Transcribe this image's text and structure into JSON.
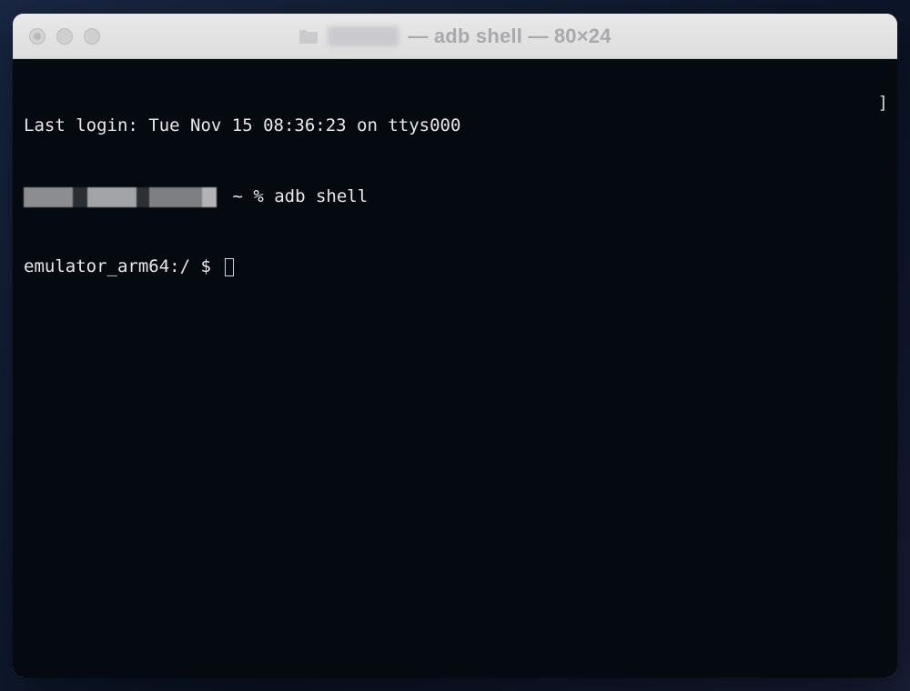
{
  "titlebar": {
    "title_suffix": "— adb shell — 80×24",
    "folder_icon_name": "folder-icon"
  },
  "terminal": {
    "last_login": "Last login: Tue Nov 15 08:36:23 on ttys000",
    "prompt1_mid": " ~ % ",
    "prompt1_cmd": "adb shell",
    "prompt2": "emulator_arm64:/ $ ",
    "rbracket": "]"
  }
}
